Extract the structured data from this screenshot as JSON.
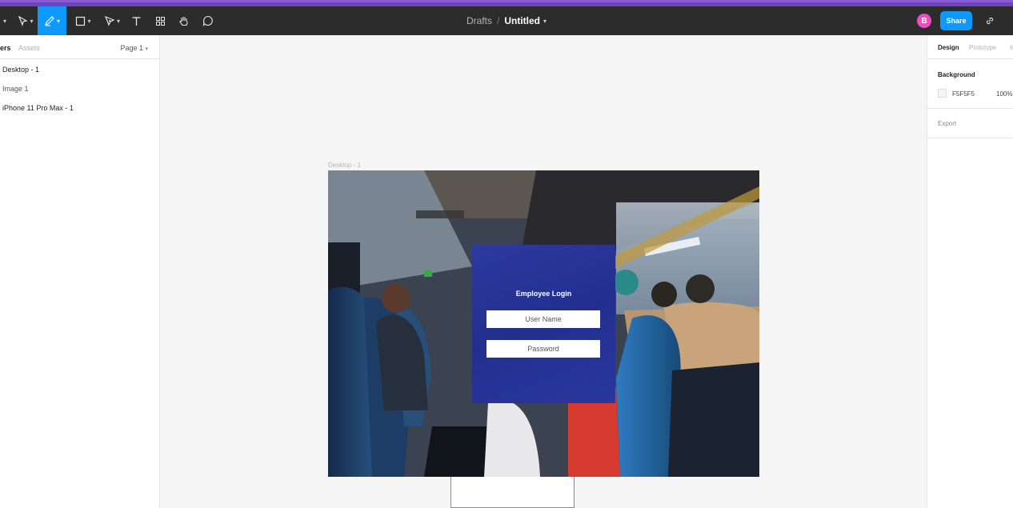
{
  "toolbar": {
    "breadcrumb": "Drafts",
    "separator": "/",
    "file_title": "Untitled",
    "avatar_initial": "B",
    "share_label": "Share",
    "icons": [
      "move-icon",
      "pen-icon",
      "frame-icon",
      "vector-icon",
      "text-icon",
      "components-icon",
      "hand-icon",
      "comment-icon"
    ]
  },
  "left_panel": {
    "tabs": [
      {
        "label": "ers",
        "active": true
      },
      {
        "label": "Assets",
        "active": false
      }
    ],
    "page_select": "Page 1",
    "layers": [
      {
        "label": "Desktop - 1"
      },
      {
        "label": "Image 1"
      },
      {
        "label": "iPhone 11 Pro Max - 1"
      }
    ]
  },
  "canvas": {
    "frame_label": "Desktop - 1",
    "login": {
      "title": "Employee Login",
      "username_label": "User Name",
      "password_label": "Password"
    }
  },
  "right_panel": {
    "tabs": [
      {
        "label": "Design",
        "active": true
      },
      {
        "label": "Prototype",
        "active": false
      },
      {
        "label": "In",
        "active": false
      }
    ],
    "background_title": "Background",
    "background_hex": "F5F5F5",
    "background_opacity": "100%",
    "export_label": "Export"
  },
  "colors": {
    "accent": "#0d99ff",
    "toolbar_bg": "#2c2c2c",
    "login_card": "#28339a",
    "avatar": "#f24bc0",
    "top_strip": "#6f42c1"
  }
}
